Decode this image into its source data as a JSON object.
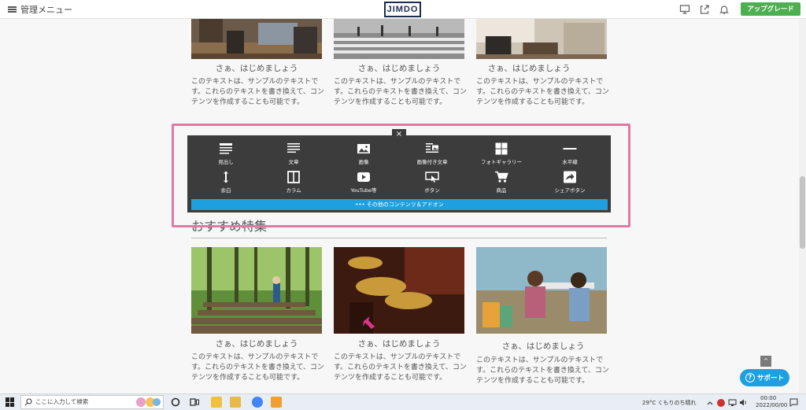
{
  "topbar": {
    "menu_label": "管理メニュー",
    "logo": "JIMDO",
    "upgrade_label": "アップグレード",
    "icons": [
      "monitor-icon",
      "share-icon",
      "bell-icon"
    ]
  },
  "top_cards": [
    {
      "caption": "さぁ、はじめましょう",
      "desc": "このテキストは、サンプルのテキストです。これらのテキストを書き換えて、コンテンツを作成することも可能です。"
    },
    {
      "caption": "さぁ、はじめましょう",
      "desc": "このテキストは、サンプルのテキストです。これらのテキストを書き換えて、コンテンツを作成することも可能です。"
    },
    {
      "caption": "さぁ、はじめましょう",
      "desc": "このテキストは、サンプルのテキストです。これらのテキストを書き換えて、コンテンツを作成することも可能です。"
    }
  ],
  "panel": {
    "close": "×",
    "tools_row1": [
      {
        "label": "見出し",
        "icon": "heading-icon"
      },
      {
        "label": "文章",
        "icon": "text-icon"
      },
      {
        "label": "画像",
        "icon": "image-icon"
      },
      {
        "label": "画像付き文章",
        "icon": "image-text-icon"
      },
      {
        "label": "フォトギャラリー",
        "icon": "gallery-icon"
      },
      {
        "label": "水平線",
        "icon": "horizontal-line-icon"
      }
    ],
    "tools_row2": [
      {
        "label": "余白",
        "icon": "spacer-icon"
      },
      {
        "label": "カラム",
        "icon": "column-icon"
      },
      {
        "label": "YouTube等",
        "icon": "video-icon"
      },
      {
        "label": "ボタン",
        "icon": "button-icon"
      },
      {
        "label": "商品",
        "icon": "cart-icon"
      },
      {
        "label": "シェアボタン",
        "icon": "share-button-icon"
      }
    ],
    "more_label": "••• その他のコンテンツ＆アドオン"
  },
  "section": {
    "title": "おすすめ特集"
  },
  "bottom_cards": [
    {
      "caption": "さぁ、はじめましょう",
      "desc": "このテキストは、サンプルのテキストです。これらのテキストを書き換えて、コンテンツを作成することも可能です。"
    },
    {
      "caption": "さぁ、はじめましょう",
      "desc": "このテキストは、サンプルのテキストです。これらのテキストを書き換えて、コンテンツを作成することも可能です。"
    },
    {
      "caption": "さぁ、はじめましょう",
      "desc": "このテキストは、サンプルのテキストです。これらのテキストを書き換えて、コンテンツを作成することも可能です。"
    }
  ],
  "support": {
    "label": "サポート",
    "up": "^"
  },
  "taskbar": {
    "search_placeholder": "ここに入力して検索",
    "weather": "29°C  くもりのち晴れ",
    "time": "00:00",
    "date": "2022/00/00"
  },
  "colors": {
    "accent": "#1ea0e0",
    "upgrade": "#4caf50",
    "highlight": "#e07aa3",
    "panel": "#3c3c3c"
  }
}
